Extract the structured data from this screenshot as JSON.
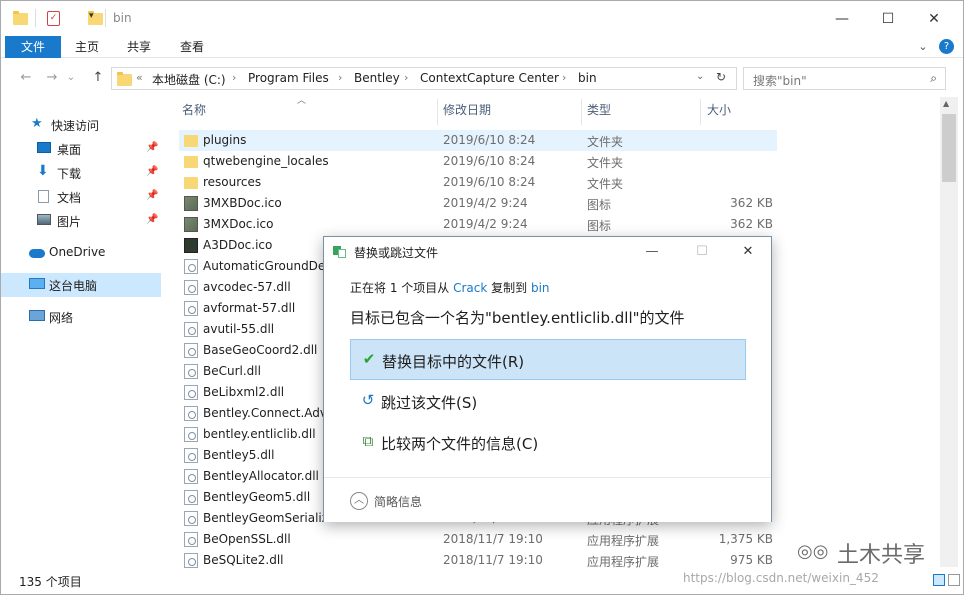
{
  "window": {
    "title": "bin",
    "minimize": "—",
    "maximize": "☐",
    "close": "✕"
  },
  "ribbon": {
    "tabs": [
      "文件",
      "主页",
      "共享",
      "查看"
    ],
    "expand_icon": "chevron-down-icon",
    "help_icon": "?"
  },
  "nav": {
    "back": "←",
    "forward": "→",
    "recent": "⌄",
    "up": "↑",
    "overflow": "«",
    "breadcrumbs": [
      "本地磁盘 (C:)",
      "Program Files",
      "Bentley",
      "ContextCapture Center",
      "bin"
    ],
    "refresh": "↻",
    "search_placeholder": "搜索\"bin\""
  },
  "sidebar": {
    "items": [
      {
        "label": "快速访问",
        "icon": "star-icon",
        "pinned": false
      },
      {
        "label": "桌面",
        "icon": "desktop-icon",
        "pinned": true
      },
      {
        "label": "下载",
        "icon": "download-icon",
        "pinned": true
      },
      {
        "label": "文档",
        "icon": "documents-icon",
        "pinned": true
      },
      {
        "label": "图片",
        "icon": "pictures-icon",
        "pinned": true
      },
      {
        "label": "OneDrive",
        "icon": "cloud-icon",
        "pinned": false
      },
      {
        "label": "这台电脑",
        "icon": "computer-icon",
        "pinned": false,
        "selected": true
      },
      {
        "label": "网络",
        "icon": "network-icon",
        "pinned": false
      }
    ]
  },
  "columns": {
    "name": "名称",
    "date": "修改日期",
    "type": "类型",
    "size": "大小"
  },
  "files": [
    {
      "name": "plugins",
      "date": "2019/6/10 8:24",
      "type": "文件夹",
      "size": "",
      "kind": "folder",
      "selected": true
    },
    {
      "name": "qtwebengine_locales",
      "date": "2019/6/10 8:24",
      "type": "文件夹",
      "size": "",
      "kind": "folder"
    },
    {
      "name": "resources",
      "date": "2019/6/10 8:24",
      "type": "文件夹",
      "size": "",
      "kind": "folder"
    },
    {
      "name": "3MXBDoc.ico",
      "date": "2019/4/2 9:24",
      "type": "图标",
      "size": "362 KB",
      "kind": "img"
    },
    {
      "name": "3MXDoc.ico",
      "date": "2019/4/2 9:24",
      "type": "图标",
      "size": "362 KB",
      "kind": "img"
    },
    {
      "name": "A3DDoc.ico",
      "date": "",
      "type": "",
      "size": "",
      "kind": "dark"
    },
    {
      "name": "AutomaticGroundDet",
      "date": "",
      "type": "",
      "size": "",
      "kind": "doc"
    },
    {
      "name": "avcodec-57.dll",
      "date": "",
      "type": "",
      "size": "",
      "kind": "doc"
    },
    {
      "name": "avformat-57.dll",
      "date": "",
      "type": "",
      "size": "",
      "kind": "doc"
    },
    {
      "name": "avutil-55.dll",
      "date": "",
      "type": "",
      "size": "",
      "kind": "doc"
    },
    {
      "name": "BaseGeoCoord2.dll",
      "date": "",
      "type": "",
      "size": "",
      "kind": "doc"
    },
    {
      "name": "BeCurl.dll",
      "date": "",
      "type": "",
      "size": "",
      "kind": "doc"
    },
    {
      "name": "BeLibxml2.dll",
      "date": "",
      "type": "",
      "size": "",
      "kind": "doc"
    },
    {
      "name": "Bentley.Connect.Advi",
      "date": "",
      "type": "",
      "size": "",
      "kind": "doc"
    },
    {
      "name": "bentley.entliclib.dll",
      "date": "",
      "type": "",
      "size": "",
      "kind": "doc"
    },
    {
      "name": "Bentley5.dll",
      "date": "",
      "type": "",
      "size": "",
      "kind": "doc"
    },
    {
      "name": "BentleyAllocator.dll",
      "date": "",
      "type": "",
      "size": "",
      "kind": "doc"
    },
    {
      "name": "BentleyGeom5.dll",
      "date": "",
      "type": "",
      "size": "",
      "kind": "doc"
    },
    {
      "name": "BentleyGeomSerializa",
      "date": "2018/11/7 19:10",
      "type": "应用程序扩展",
      "size": "",
      "kind": "doc"
    },
    {
      "name": "BeOpenSSL.dll",
      "date": "2018/11/7 19:10",
      "type": "应用程序扩展",
      "size": "1,375 KB",
      "kind": "doc"
    },
    {
      "name": "BeSQLite2.dll",
      "date": "2018/11/7 19:10",
      "type": "应用程序扩展",
      "size": "975 KB",
      "kind": "doc"
    }
  ],
  "status": {
    "item_count": "135 个项目"
  },
  "dialog": {
    "title": "替换或跳过文件",
    "min": "—",
    "max": "☐",
    "close": "✕",
    "line1_prefix": "正在将 1 个项目从 ",
    "line1_src": "Crack",
    "line1_mid": " 复制到 ",
    "line1_dst": "bin",
    "line2": "目标已包含一个名为\"bentley.entliclib.dll\"的文件",
    "options": [
      {
        "label": "替换目标中的文件(R)",
        "icon": "checkmark-icon",
        "glyph": "✔"
      },
      {
        "label": "跳过该文件(S)",
        "icon": "skip-icon",
        "glyph": "↺"
      },
      {
        "label": "比较两个文件的信息(C)",
        "icon": "compare-icon",
        "glyph": "⧉"
      }
    ],
    "more_label": "简略信息",
    "more_glyph": "︿"
  },
  "watermark": {
    "text": "土木共享",
    "url": "https://blog.csdn.net/weixin_452"
  }
}
